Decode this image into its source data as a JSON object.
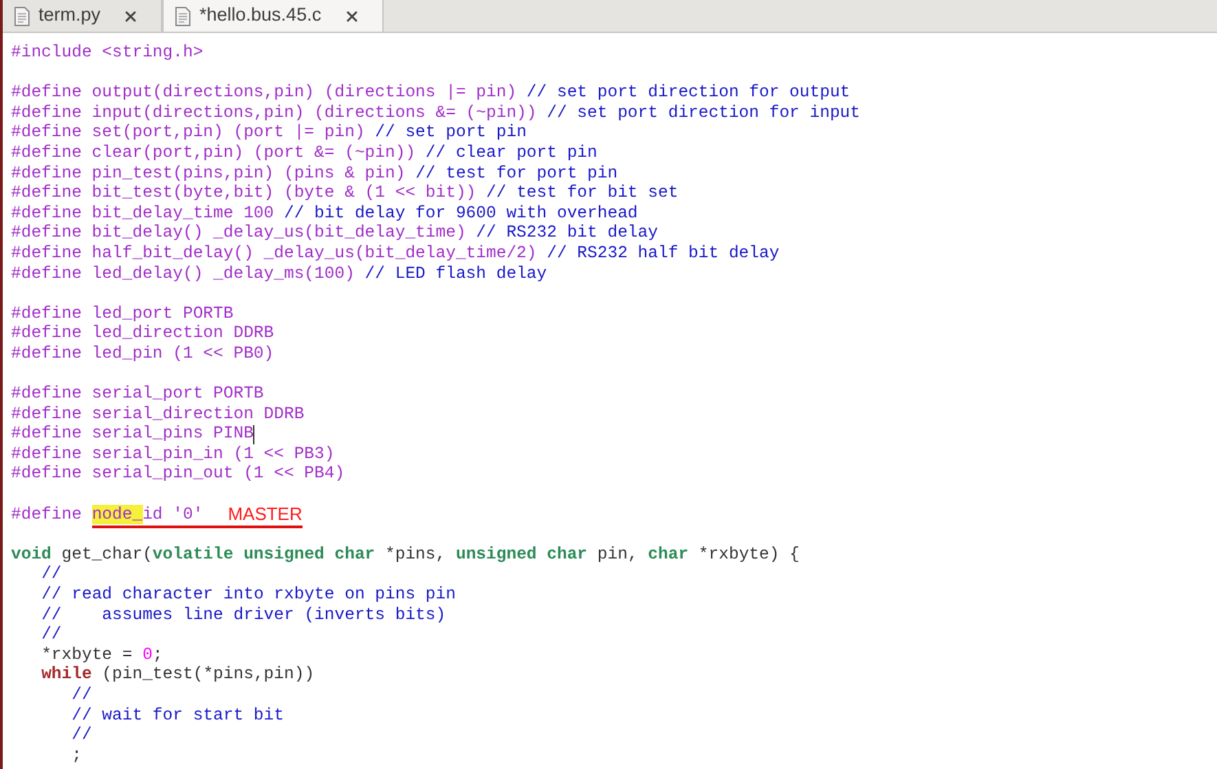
{
  "tabs": [
    {
      "label": "term.py",
      "selected": false
    },
    {
      "label": "*hello.bus.45.c",
      "selected": true
    }
  ],
  "lines": [
    {
      "kind": "code",
      "cursor": false,
      "segments": [
        {
          "kind": "preproc",
          "text": "#include <string.h>"
        }
      ]
    },
    {
      "kind": "blank",
      "cursor": false
    },
    {
      "kind": "code",
      "cursor": false,
      "segments": [
        {
          "kind": "preproc",
          "text": "#define output(directions,pin) (directions |= pin) "
        },
        {
          "kind": "comment",
          "text": "// set port direction for output"
        }
      ]
    },
    {
      "kind": "code",
      "cursor": false,
      "segments": [
        {
          "kind": "preproc",
          "text": "#define input(directions,pin) (directions &= (~pin)) "
        },
        {
          "kind": "comment",
          "text": "// set port direction for input"
        }
      ]
    },
    {
      "kind": "code",
      "cursor": false,
      "segments": [
        {
          "kind": "preproc",
          "text": "#define set(port,pin) (port |= pin) "
        },
        {
          "kind": "comment",
          "text": "// set port pin"
        }
      ]
    },
    {
      "kind": "code",
      "cursor": false,
      "segments": [
        {
          "kind": "preproc",
          "text": "#define clear(port,pin) (port &= (~pin)) "
        },
        {
          "kind": "comment",
          "text": "// clear port pin"
        }
      ]
    },
    {
      "kind": "code",
      "cursor": false,
      "segments": [
        {
          "kind": "preproc",
          "text": "#define pin_test(pins,pin) (pins & pin) "
        },
        {
          "kind": "comment",
          "text": "// test for port pin"
        }
      ]
    },
    {
      "kind": "code",
      "cursor": false,
      "segments": [
        {
          "kind": "preproc",
          "text": "#define bit_test(byte,bit) (byte & (1 << bit)) "
        },
        {
          "kind": "comment",
          "text": "// test for bit set"
        }
      ]
    },
    {
      "kind": "code",
      "cursor": false,
      "segments": [
        {
          "kind": "preproc",
          "text": "#define bit_delay_time 100 "
        },
        {
          "kind": "comment",
          "text": "// bit delay for 9600 with overhead"
        }
      ]
    },
    {
      "kind": "code",
      "cursor": false,
      "segments": [
        {
          "kind": "preproc",
          "text": "#define bit_delay() _delay_us(bit_delay_time) "
        },
        {
          "kind": "comment",
          "text": "// RS232 bit delay"
        }
      ]
    },
    {
      "kind": "code",
      "cursor": false,
      "segments": [
        {
          "kind": "preproc",
          "text": "#define half_bit_delay() _delay_us(bit_delay_time/2) "
        },
        {
          "kind": "comment",
          "text": "// RS232 half bit delay"
        }
      ]
    },
    {
      "kind": "code",
      "cursor": false,
      "segments": [
        {
          "kind": "preproc",
          "text": "#define led_delay() _delay_ms(100) "
        },
        {
          "kind": "comment",
          "text": "// LED flash delay"
        }
      ]
    },
    {
      "kind": "blank",
      "cursor": false
    },
    {
      "kind": "code",
      "cursor": false,
      "segments": [
        {
          "kind": "preproc",
          "text": "#define led_port PORTB"
        }
      ]
    },
    {
      "kind": "code",
      "cursor": false,
      "segments": [
        {
          "kind": "preproc",
          "text": "#define led_direction DDRB"
        }
      ]
    },
    {
      "kind": "code",
      "cursor": false,
      "segments": [
        {
          "kind": "preproc",
          "text": "#define led_pin (1 << PB0)"
        }
      ]
    },
    {
      "kind": "blank",
      "cursor": false
    },
    {
      "kind": "code",
      "cursor": false,
      "segments": [
        {
          "kind": "preproc",
          "text": "#define serial_port PORTB"
        }
      ]
    },
    {
      "kind": "code",
      "cursor": false,
      "segments": [
        {
          "kind": "preproc",
          "text": "#define serial_direction DDRB"
        }
      ]
    },
    {
      "kind": "code",
      "cursor": true,
      "segments": [
        {
          "kind": "preproc",
          "text": "#define serial_pins PINB"
        }
      ]
    },
    {
      "kind": "code",
      "cursor": false,
      "segments": [
        {
          "kind": "preproc",
          "text": "#define serial_pin_in (1 << PB3)"
        }
      ]
    },
    {
      "kind": "code",
      "cursor": false,
      "segments": [
        {
          "kind": "preproc",
          "text": "#define serial_pin_out (1 << PB4)"
        }
      ]
    },
    {
      "kind": "blank",
      "cursor": false
    },
    {
      "kind": "code",
      "cursor": false,
      "annotation": "MASTER",
      "segments": [
        {
          "kind": "preproc",
          "text": "#define "
        },
        {
          "kind": "highlight",
          "text": "node_"
        },
        {
          "kind": "preproc",
          "text": "id '0'"
        }
      ]
    },
    {
      "kind": "blank",
      "cursor": false
    },
    {
      "kind": "code",
      "cursor": false,
      "segments": [
        {
          "kind": "type",
          "text": "void"
        },
        {
          "kind": "plain",
          "text": " get_char("
        },
        {
          "kind": "type",
          "text": "volatile unsigned char"
        },
        {
          "kind": "plain",
          "text": " *pins, "
        },
        {
          "kind": "type",
          "text": "unsigned char"
        },
        {
          "kind": "plain",
          "text": " pin, "
        },
        {
          "kind": "type",
          "text": "char"
        },
        {
          "kind": "plain",
          "text": " *rxbyte) {"
        }
      ]
    },
    {
      "kind": "code",
      "cursor": false,
      "segments": [
        {
          "kind": "comment",
          "text": "   //"
        }
      ]
    },
    {
      "kind": "code",
      "cursor": false,
      "segments": [
        {
          "kind": "comment",
          "text": "   // read character into rxbyte on pins pin"
        }
      ]
    },
    {
      "kind": "code",
      "cursor": false,
      "segments": [
        {
          "kind": "comment",
          "text": "   //    assumes line driver (inverts bits)"
        }
      ]
    },
    {
      "kind": "code",
      "cursor": false,
      "segments": [
        {
          "kind": "comment",
          "text": "   //"
        }
      ]
    },
    {
      "kind": "code",
      "cursor": false,
      "segments": [
        {
          "kind": "plain",
          "text": "   *rxbyte = "
        },
        {
          "kind": "number",
          "text": "0"
        },
        {
          "kind": "plain",
          "text": ";"
        }
      ]
    },
    {
      "kind": "code",
      "cursor": false,
      "segments": [
        {
          "kind": "keyword",
          "text": "   while"
        },
        {
          "kind": "plain",
          "text": " (pin_test(*pins,pin))"
        }
      ]
    },
    {
      "kind": "code",
      "cursor": false,
      "segments": [
        {
          "kind": "comment",
          "text": "      //"
        }
      ]
    },
    {
      "kind": "code",
      "cursor": false,
      "segments": [
        {
          "kind": "comment",
          "text": "      // wait for start bit"
        }
      ]
    },
    {
      "kind": "code",
      "cursor": false,
      "segments": [
        {
          "kind": "comment",
          "text": "      //"
        }
      ]
    },
    {
      "kind": "code",
      "cursor": false,
      "segments": [
        {
          "kind": "plain",
          "text": "      ;"
        }
      ]
    }
  ]
}
